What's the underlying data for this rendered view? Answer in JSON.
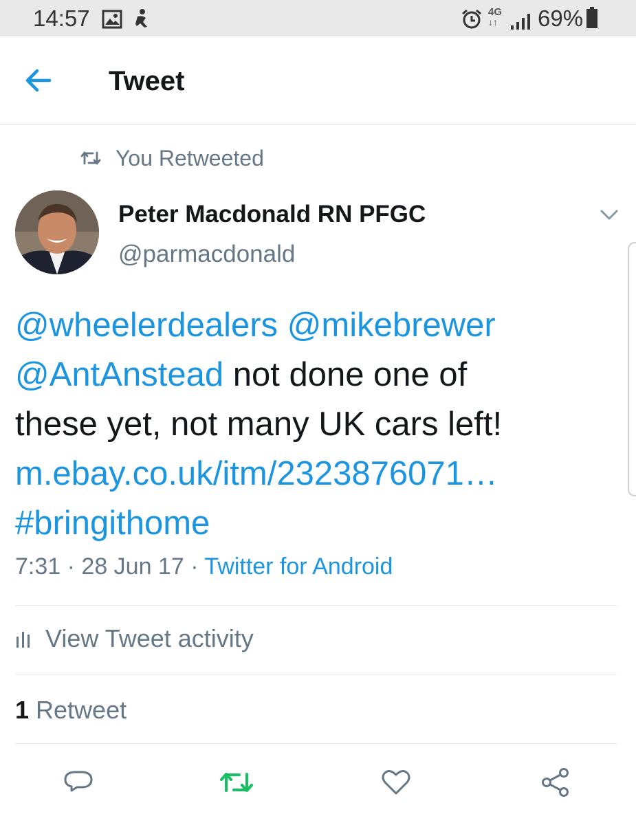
{
  "status_bar": {
    "time": "14:57",
    "network": "4G",
    "battery": "69%"
  },
  "header": {
    "title": "Tweet"
  },
  "retweet_context": {
    "label": "You Retweeted"
  },
  "author": {
    "name": "Peter Macdonald RN PFGC",
    "handle": "@parmacdonald"
  },
  "tweet": {
    "mention1": "@wheelerdealers",
    "mention2": "@mikebrewer",
    "mention3": "@AntAnstead",
    "text_part1": " not done one of",
    "text_part2": "these yet, not many UK cars left!",
    "link": "m.ebay.co.uk/itm/2323876071…",
    "hashtag": "#bringithome"
  },
  "meta": {
    "time": "7:31",
    "date": "28 Jun 17",
    "source": "Twitter for Android",
    "sep": " · "
  },
  "activity": {
    "label": "View Tweet activity"
  },
  "stats": {
    "retweet_count": "1",
    "retweet_label": "Retweet"
  },
  "colors": {
    "accent": "#1b95e0",
    "retweet_active": "#17bf63",
    "secondary_text": "#657786",
    "primary_text": "#14171a"
  },
  "icons": {
    "back": "arrow-left-icon",
    "retweet_context": "retweet-icon",
    "caret": "chevron-down-icon",
    "activity": "bar-chart-icon",
    "reply": "reply-icon",
    "retweet": "retweet-icon",
    "like": "heart-icon",
    "share": "share-icon"
  }
}
